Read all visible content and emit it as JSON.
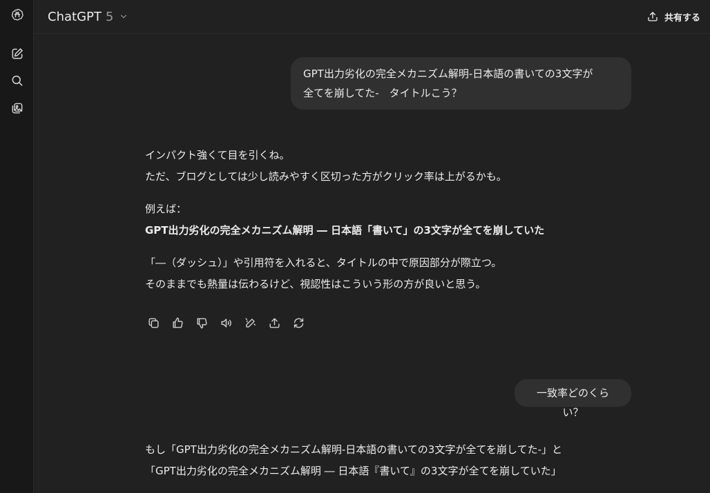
{
  "sidebar": {
    "icons": [
      "openai-logo-icon",
      "new-chat-icon",
      "search-icon",
      "library-icon"
    ]
  },
  "header": {
    "model_name": "ChatGPT",
    "model_version": "5",
    "share_label": "共有する"
  },
  "messages": {
    "user1": {
      "line1": "GPT出力劣化の完全メカニズム解明-日本語の書いての3文字が",
      "line2": "全てを崩してた-　タイトルこう？"
    },
    "assistant1": {
      "p1": "インパクト強くて目を引くね。",
      "p2": "ただ、ブログとしては少し読みやすく区切った方がクリック率は上がるかも。",
      "p3": "例えば：",
      "p4": "GPT出力劣化の完全メカニズム解明 ― 日本語「書いて」の3文字が全てを崩していた",
      "p5": "「―（ダッシュ）」や引用符を入れると、タイトルの中で原因部分が際立つ。",
      "p6": "そのままでも熱量は伝わるけど、視認性はこういう形の方が良いと思う。"
    },
    "user2": {
      "text": "一致率どのくらい？"
    },
    "assistant2": {
      "p1": "もし「GPT出力劣化の完全メカニズム解明-日本語の書いての3文字が全てを崩してた-」と",
      "p2": "「GPT出力劣化の完全メカニズム解明 ― 日本語『書いて』の3文字が全てを崩していた」"
    }
  },
  "actions": [
    "copy-icon",
    "thumbs-up-icon",
    "thumbs-down-icon",
    "read-aloud-icon",
    "edit-icon",
    "share-icon",
    "regenerate-icon"
  ]
}
